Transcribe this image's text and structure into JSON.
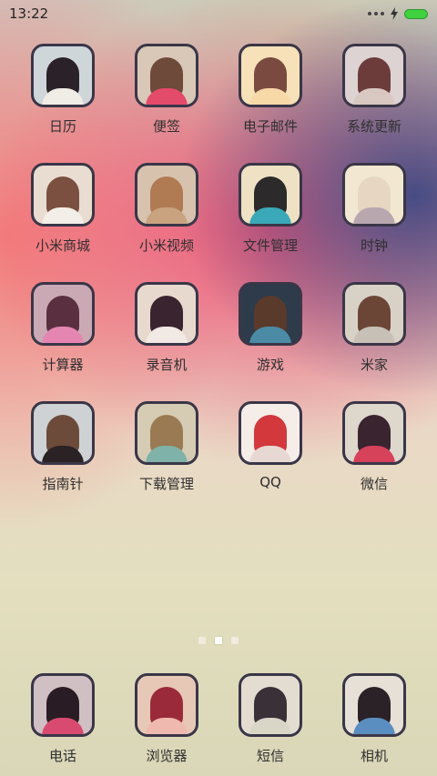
{
  "status_bar": {
    "time": "13:22"
  },
  "pager": {
    "pages": 3,
    "active": 1
  },
  "apps": [
    {
      "label": "日历",
      "tile": [
        "#cfd6da",
        "#2a2228",
        "#f0ece6"
      ]
    },
    {
      "label": "便签",
      "tile": [
        "#d9c7b7",
        "#6d4a3a",
        "#e44a6a"
      ]
    },
    {
      "label": "电子邮件",
      "tile": [
        "#f6e1b8",
        "#7a4a40",
        "#f7d9a8"
      ]
    },
    {
      "label": "系统更新",
      "tile": [
        "#dcd3d2",
        "#6c3c3a",
        "#d9c8c1"
      ]
    },
    {
      "label": "小米商城",
      "tile": [
        "#e9ddd1",
        "#7b5040",
        "#f3efe8"
      ]
    },
    {
      "label": "小米视频",
      "tile": [
        "#d7c2ae",
        "#b07a52",
        "#c9a27f"
      ]
    },
    {
      "label": "文件管理",
      "tile": [
        "#efe2c4",
        "#2c2a2a",
        "#3aa8b6"
      ]
    },
    {
      "label": "时钟",
      "tile": [
        "#f2e8d2",
        "#e6d6c2",
        "#b9a7b0"
      ]
    },
    {
      "label": "计算器",
      "tile": [
        "#caa9b4",
        "#5a3040",
        "#e586b2"
      ]
    },
    {
      "label": "录音机",
      "tile": [
        "#e8d9cf",
        "#3a2430",
        "#f1e9e4"
      ]
    },
    {
      "label": "游戏",
      "tile": [
        "#2d3b4a",
        "#5a3a2a",
        "#4c8ba6"
      ]
    },
    {
      "label": "米家",
      "tile": [
        "#d8d2c6",
        "#6b4636",
        "#c6c0b6"
      ]
    },
    {
      "label": "指南针",
      "tile": [
        "#cfd2d4",
        "#6c4b3a",
        "#2a2224"
      ]
    },
    {
      "label": "下载管理",
      "tile": [
        "#d6ccb4",
        "#9a7a52",
        "#7fb2a8"
      ]
    },
    {
      "label": "QQ",
      "tile": [
        "#f4ede8",
        "#d2383c",
        "#e8d8d4"
      ]
    },
    {
      "label": "微信",
      "tile": [
        "#ddd7cc",
        "#3a2430",
        "#d6425a"
      ]
    }
  ],
  "dock": [
    {
      "label": "电话",
      "tile": [
        "#d0c0c4",
        "#2a1c24",
        "#d84a70"
      ]
    },
    {
      "label": "浏览器",
      "tile": [
        "#e7c8b6",
        "#9a2a3a",
        "#efb9b0"
      ]
    },
    {
      "label": "短信",
      "tile": [
        "#e2ddd0",
        "#3a3038",
        "#d9d6c8"
      ]
    },
    {
      "label": "相机",
      "tile": [
        "#e6e0d6",
        "#2a2226",
        "#5a8ec0"
      ]
    }
  ]
}
